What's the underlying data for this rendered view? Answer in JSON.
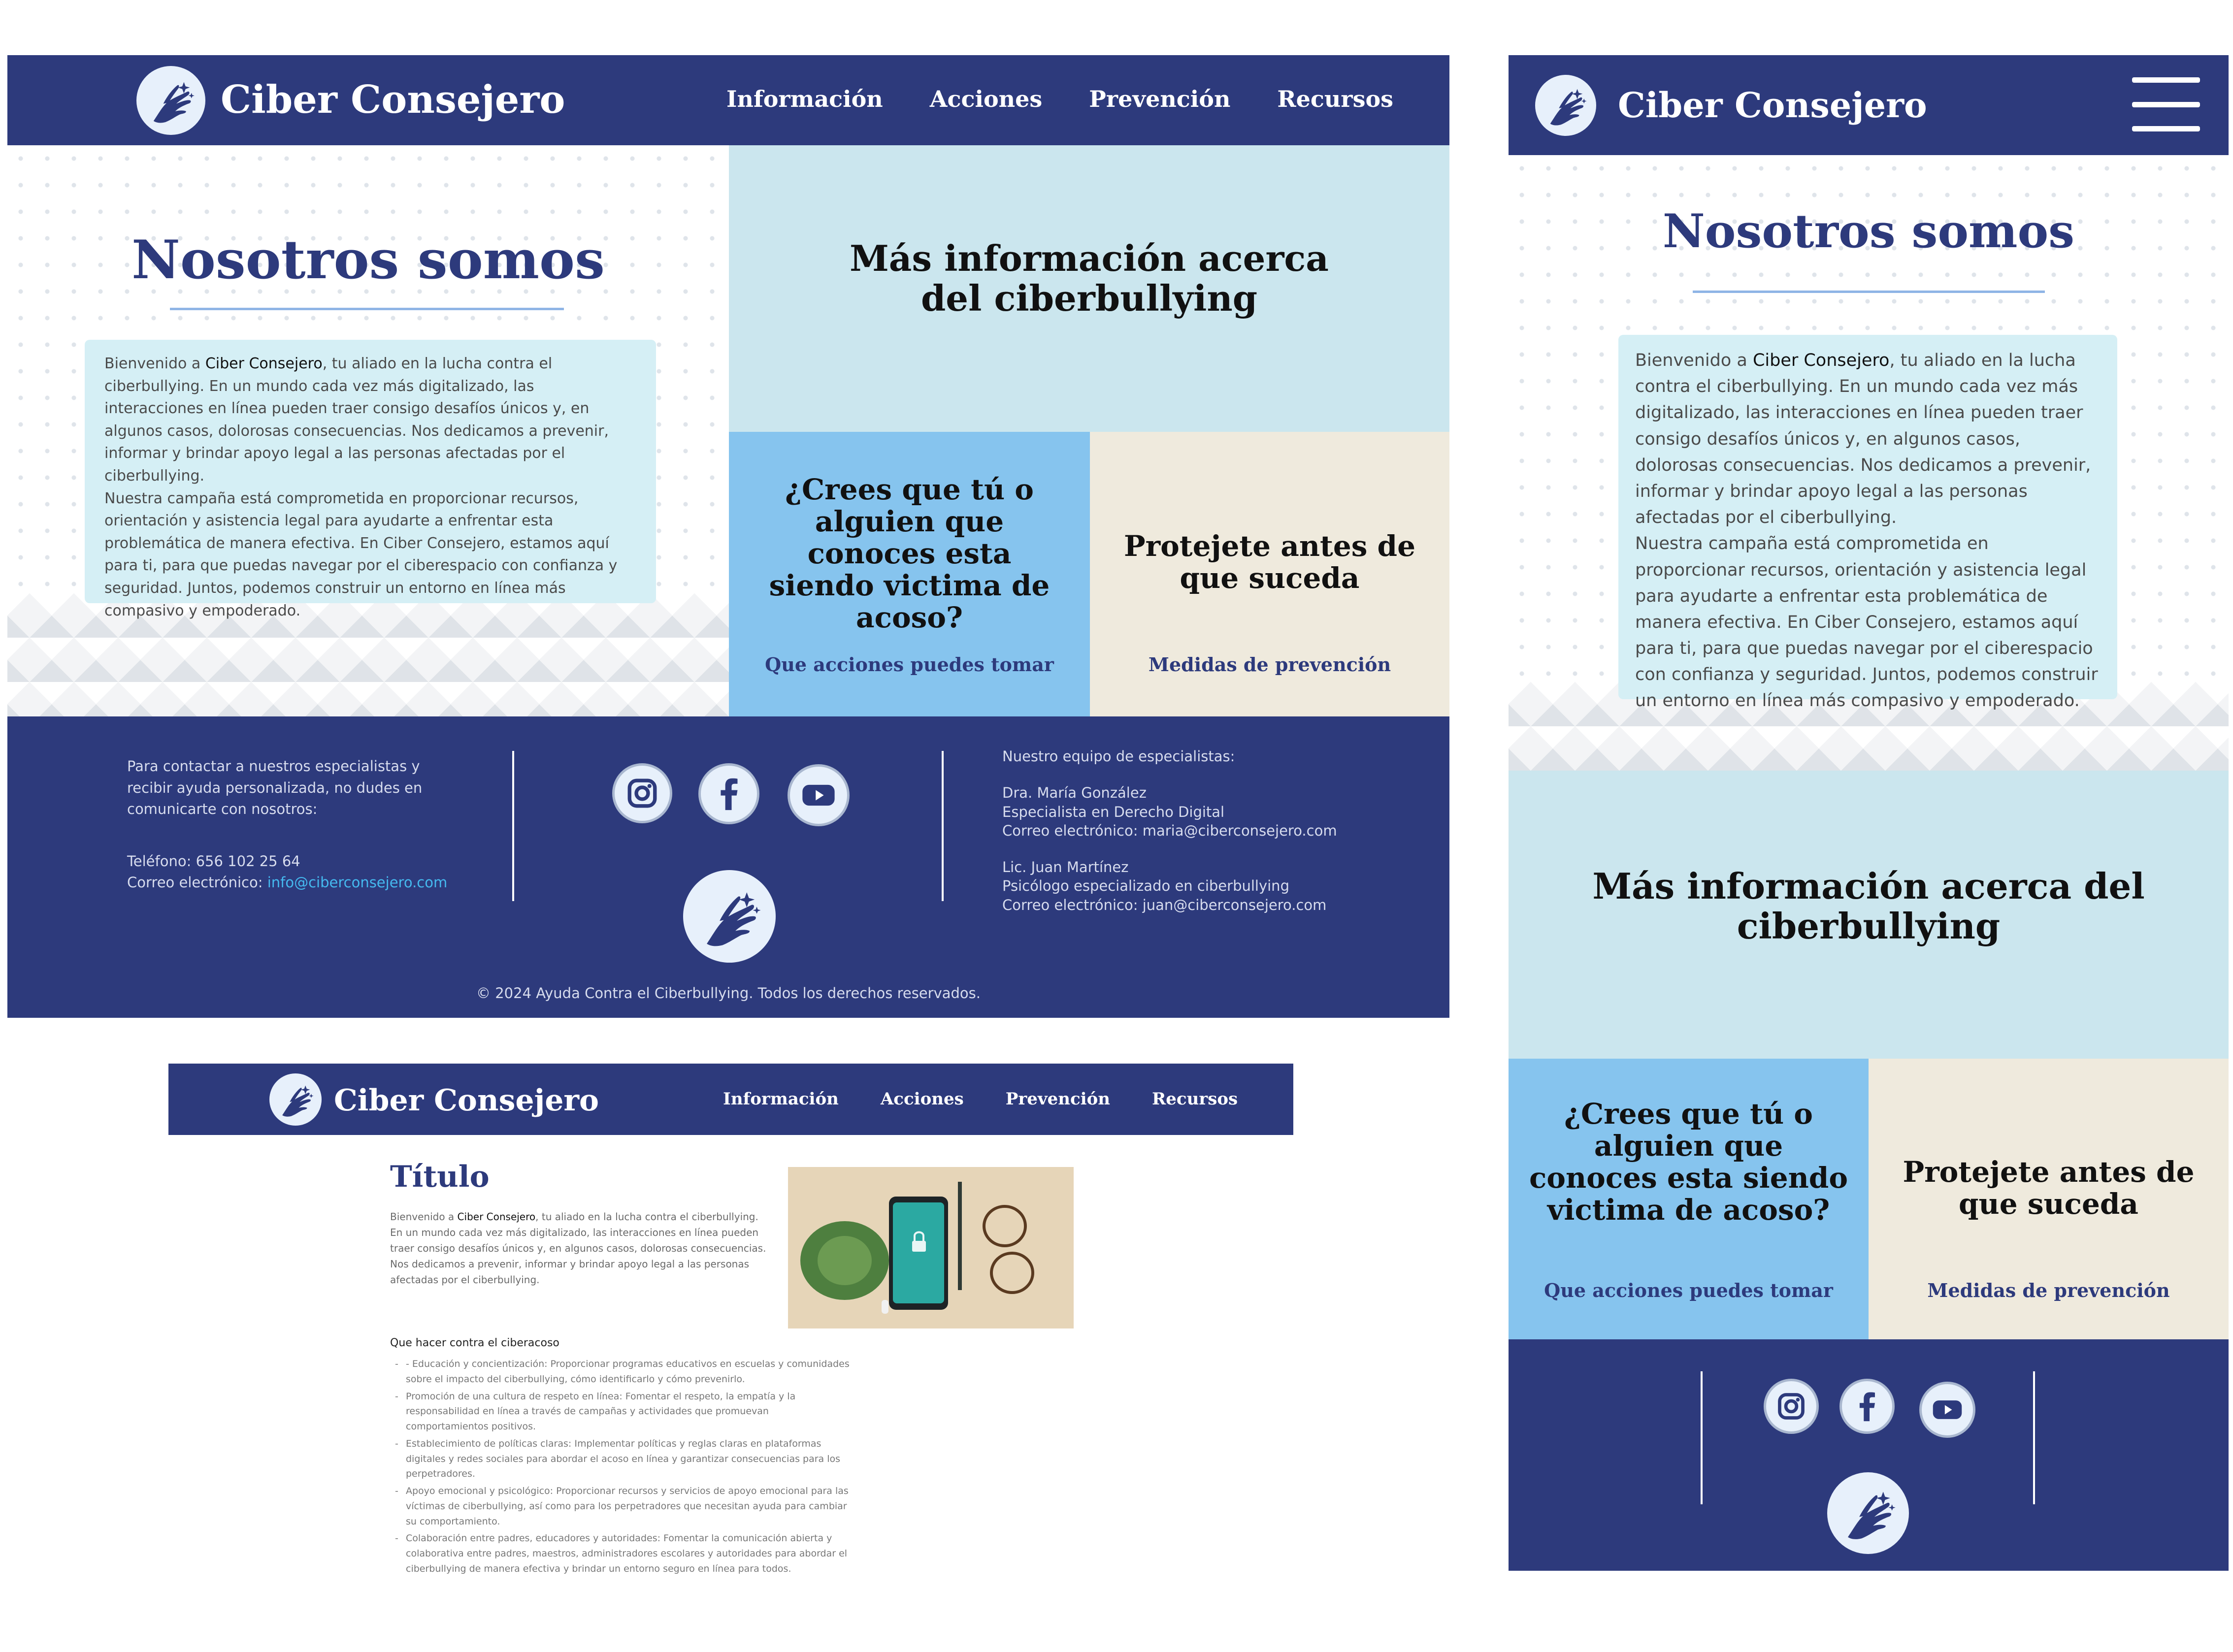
{
  "brand": {
    "name": "Ciber Consejero"
  },
  "nav": {
    "items": [
      "Información",
      "Acciones",
      "Prevención",
      "Recursos"
    ]
  },
  "about": {
    "title": "Nosotros somos",
    "p1_prefix": "Bienvenido a ",
    "p1_brand": "Ciber Consejero",
    "p1_rest": ", tu aliado en la lucha contra el ciberbullying. En un mundo cada vez más digitalizado, las interacciones en línea pueden traer consigo desafíos únicos y, en algunos casos, dolorosas consecuencias. Nos dedicamos a prevenir, informar y brindar apoyo legal a las personas afectadas por el ciberbullying.",
    "p2": "Nuestra campaña está comprometida en proporcionar recursos, orientación y asistencia legal para ayudarte a enfrentar esta problemática de manera efectiva. En Ciber Consejero, estamos aquí para ti, para que puedas navegar por el ciberespacio con confianza y seguridad. Juntos, podemos construir un entorno en línea más compasivo y empoderado."
  },
  "tiles": {
    "info_title": "Más información acerca del ciberbullying",
    "victim_title": "¿Crees que tú o alguien que conoces esta siendo victima de acoso?",
    "victim_link": "Que acciones puedes tomar",
    "protect_title": "Protejete antes de que suceda",
    "protect_link": "Medidas de prevención"
  },
  "footer": {
    "contact_intro": "Para contactar a nuestros especialistas y recibir ayuda personalizada, no dudes en comunicarte con nosotros:",
    "phone": "Teléfono: 656 102 25 64",
    "email_label": "Correo electrónico: ",
    "email": "info@ciberconsejero.com",
    "team_title": "Nuestro equipo de especialistas:",
    "s1_name": "Dra. María González",
    "s1_role": "Especialista en Derecho Digital",
    "s1_email": "Correo electrónico: maria@ciberconsejero.com",
    "s2_name": "Lic. Juan Martínez",
    "s2_role": "Psicólogo especializado en ciberbullying",
    "s2_email": "Correo electrónico: juan@ciberconsejero.com",
    "copyright": "© 2024 Ayuda Contra el Ciberbullying. Todos los derechos reservados.",
    "social": [
      "instagram-icon",
      "facebook-icon",
      "youtube-icon"
    ]
  },
  "detail": {
    "title": "Título",
    "intro_prefix": "Bienvenido a ",
    "intro_brand": "Ciber Consejero",
    "intro_rest": ", tu aliado en la lucha contra el ciberbullying. En un mundo cada vez más digitalizado, las interacciones en línea pueden traer consigo desafíos únicos y, en algunos casos, dolorosas consecuencias. Nos dedicamos a prevenir, informar y brindar apoyo legal a las personas afectadas por el ciberbullying.",
    "subtitle": "Que hacer contra el ciberacoso",
    "list": [
      "- Educación y concientización: Proporcionar programas educativos en escuelas y comunidades sobre el impacto del ciberbullying, cómo identificarlo y cómo prevenirlo.",
      "Promoción de una cultura de respeto en línea: Fomentar el respeto, la empatía y la responsabilidad en línea a través de campañas y actividades que promuevan comportamientos positivos.",
      "Establecimiento de políticas claras: Implementar políticas y reglas claras en plataformas digitales y redes sociales para abordar el acoso en línea y garantizar consecuencias para los perpetradores.",
      "Apoyo emocional y psicológico: Proporcionar recursos y servicios de apoyo emocional para las víctimas de ciberbullying, así como para los perpetradores que necesitan ayuda para cambiar su comportamiento.",
      "Colaboración entre padres, educadores y autoridades: Fomentar la comunicación abierta y colaborativa entre padres, maestros, administradores escolares y autoridades para abordar el ciberbullying de manera efectiva y brindar un entorno seguro en línea para todos."
    ]
  },
  "colors": {
    "navy": "#2d3a7c",
    "light_cyan": "#d5eff5",
    "sky": "#86c4ee",
    "link_blue": "#45b9ef"
  }
}
